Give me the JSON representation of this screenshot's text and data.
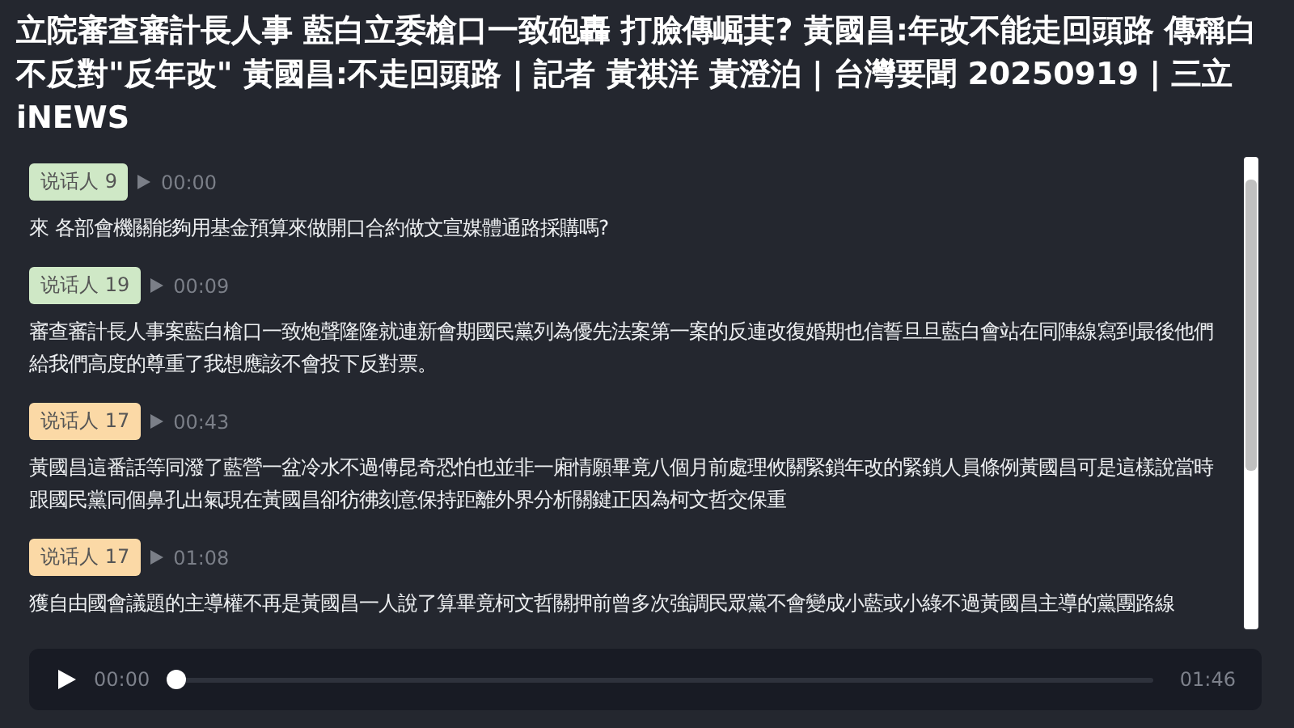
{
  "title": "立院審查審計長人事 藍白立委槍口一致砲轟 打臉傳崛萁? 黃國昌:年改不能走回頭路 傳稱白不反對\"反年改\" 黃國昌:不走回頭路 | 記者 黃祺洋 黃澄泊 | 台灣要聞 20250919 | 三立iNEWS",
  "transcript": [
    {
      "speaker": "说话人 9",
      "color": "#cfe8c6",
      "time": "00:00",
      "text": "來 各部會機關能夠用基金預算來做開口合約做文宣媒體通路採購嗎?"
    },
    {
      "speaker": "说话人 19",
      "color": "#cfe8c6",
      "time": "00:09",
      "text": "審查審計長人事案藍白槍口一致炮聲隆隆就連新會期國民黨列為優先法案第一案的反連改復婚期也信誓旦旦藍白會站在同陣線寫到最後他們給我們高度的尊重了我想應該不會投下反對票。"
    },
    {
      "speaker": "说话人 17",
      "color": "#fbd9a6",
      "time": "00:43",
      "text": "黃國昌這番話等同潑了藍營一盆冷水不過傅昆奇恐怕也並非一廂情願畢竟八個月前處理攸關緊鎖年改的緊鎖人員條例黃國昌可是這樣說當時跟國民黨同個鼻孔出氣現在黃國昌卻彷彿刻意保持距離外界分析關鍵正因為柯文哲交保重"
    },
    {
      "speaker": "说话人 17",
      "color": "#fbd9a6",
      "time": "01:08",
      "text": "獲自由國會議題的主導權不再是黃國昌一人說了算畢竟柯文哲關押前曾多次強調民眾黨不會變成小藍或小綠不過黃國昌主導的黨團路線"
    }
  ],
  "player": {
    "current": "00:00",
    "duration": "01:46",
    "level": 0
  }
}
